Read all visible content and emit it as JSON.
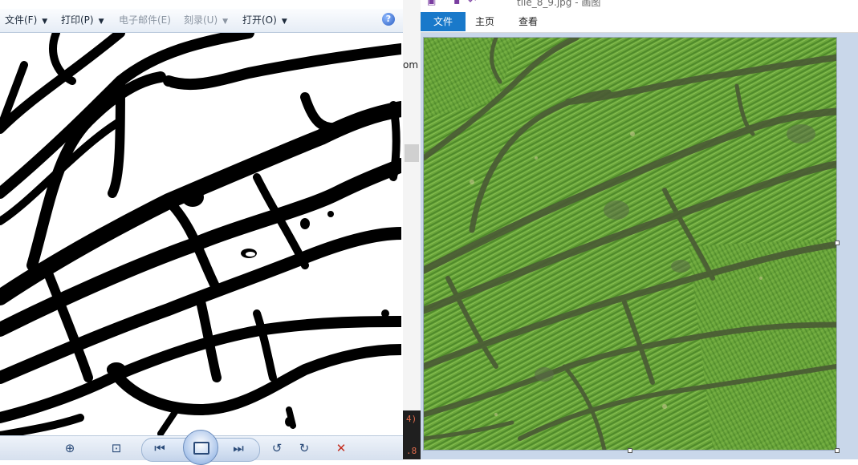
{
  "photo_viewer": {
    "menu": {
      "file": "文件(F)",
      "print": "打印(P)",
      "email": "电子邮件(E)",
      "burn": "刻录(U)",
      "open": "打开(O)"
    },
    "help_glyph": "?",
    "toolbar": {
      "zoom_icon": "magnifier-icon",
      "actual_size_icon": "fit-icon",
      "previous_icon": "previous-icon",
      "slideshow_icon": "slideshow-icon",
      "next_icon": "next-icon",
      "rotate_ccw_icon": "rotate-ccw-icon",
      "rotate_cw_icon": "rotate-cw-icon",
      "delete_icon": "delete-icon"
    }
  },
  "background_editor": {
    "partial_text": "om",
    "code_line_1": "4)",
    "code_line_2": ".8"
  },
  "paint": {
    "title": "tile_8_9.jpg - 画图",
    "tabs": {
      "file": "文件",
      "home": "主页",
      "view": "查看"
    },
    "colors": {
      "file_tab": "#1979ca",
      "canvas_background": "#c9d7ea",
      "field_green": "#5f9a35"
    }
  }
}
